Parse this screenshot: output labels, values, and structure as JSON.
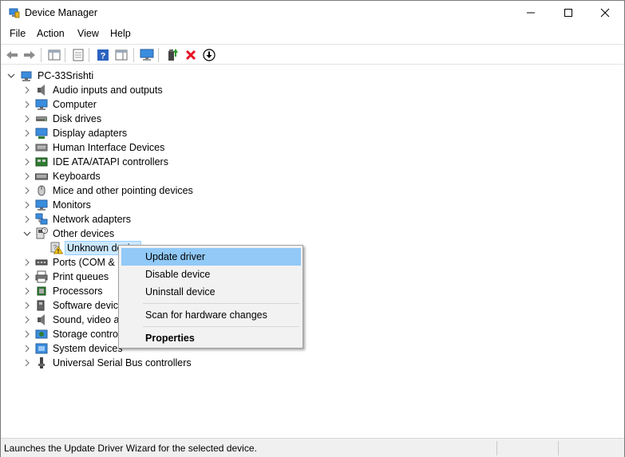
{
  "window": {
    "title": "Device Manager"
  },
  "menu": {
    "file": "File",
    "action": "Action",
    "view": "View",
    "help": "Help"
  },
  "toolbar": {
    "icons": [
      "back-arrow-icon",
      "forward-arrow-icon",
      "show-hide-console-tree-icon",
      "properties-icon",
      "help-icon",
      "action-pane-icon",
      "monitor-icon",
      "update-driver-icon",
      "uninstall-x-icon",
      "scan-download-icon"
    ],
    "accent_red": "#e81123",
    "accent_green": "#2e9a2e"
  },
  "tree": {
    "root": "PC-33Srishti",
    "categories": [
      {
        "label": "Audio inputs and outputs",
        "icon": "speaker-icon"
      },
      {
        "label": "Computer",
        "icon": "computer-icon"
      },
      {
        "label": "Disk drives",
        "icon": "disk-drive-icon"
      },
      {
        "label": "Display adapters",
        "icon": "display-adapter-icon"
      },
      {
        "label": "Human Interface Devices",
        "icon": "hid-icon"
      },
      {
        "label": "IDE ATA/ATAPI controllers",
        "icon": "ide-controller-icon"
      },
      {
        "label": "Keyboards",
        "icon": "keyboard-icon"
      },
      {
        "label": "Mice and other pointing devices",
        "icon": "mouse-icon"
      },
      {
        "label": "Monitors",
        "icon": "monitor-icon"
      },
      {
        "label": "Network adapters",
        "icon": "network-adapter-icon"
      },
      {
        "label": "Other devices",
        "icon": "other-devices-icon",
        "expanded": true
      },
      {
        "label": "Ports (COM & LPT)",
        "icon": "port-icon"
      },
      {
        "label": "Print queues",
        "icon": "printer-icon"
      },
      {
        "label": "Processors",
        "icon": "processor-icon"
      },
      {
        "label": "Software devices",
        "icon": "software-device-icon"
      },
      {
        "label": "Sound, video and game controllers",
        "icon": "sound-icon"
      },
      {
        "label": "Storage controllers",
        "icon": "storage-controller-icon"
      },
      {
        "label": "System devices",
        "icon": "system-device-icon"
      },
      {
        "label": "Universal Serial Bus controllers",
        "icon": "usb-icon"
      }
    ],
    "unknown_device": "Unknown device",
    "selection_color": "#cce8ff"
  },
  "context_menu": {
    "update_driver": "Update driver",
    "disable_device": "Disable device",
    "uninstall_device": "Uninstall device",
    "scan": "Scan for hardware changes",
    "properties": "Properties",
    "highlight_color": "#91c9f7"
  },
  "status": {
    "text": "Launches the Update Driver Wizard for the selected device."
  }
}
